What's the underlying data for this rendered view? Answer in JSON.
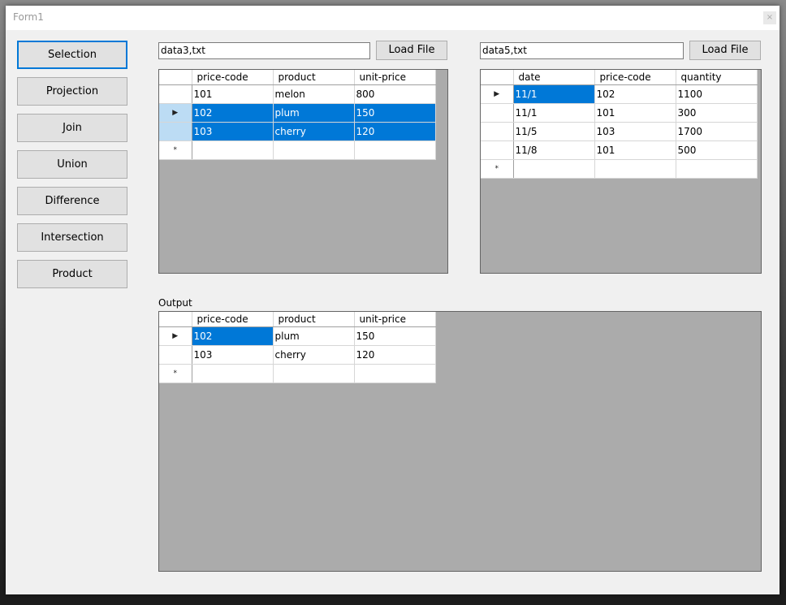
{
  "window": {
    "title": "Form1",
    "close_glyph": "×"
  },
  "sidebar": {
    "buttons": [
      {
        "label": "Selection"
      },
      {
        "label": "Projection"
      },
      {
        "label": "Join"
      },
      {
        "label": "Union"
      },
      {
        "label": "Difference"
      },
      {
        "label": "Intersection"
      },
      {
        "label": "Product"
      }
    ]
  },
  "left_panel": {
    "file_value": "data3,txt",
    "load_label": "Load File",
    "columns": [
      "price-code",
      "product",
      "unit-price"
    ],
    "rows": [
      [
        "101",
        "melon",
        "800"
      ],
      [
        "102",
        "plum",
        "150"
      ],
      [
        "103",
        "cherry",
        "120"
      ]
    ],
    "row_markers": [
      "",
      "▶",
      "",
      "*"
    ]
  },
  "right_panel": {
    "file_value": "data5,txt",
    "load_label": "Load File",
    "columns": [
      "date",
      "price-code",
      "quantity"
    ],
    "rows": [
      [
        "11/1",
        "102",
        "1100"
      ],
      [
        "11/1",
        "101",
        "300"
      ],
      [
        "11/5",
        "103",
        "1700"
      ],
      [
        "11/8",
        "101",
        "500"
      ]
    ],
    "row_markers": [
      "▶",
      "",
      "",
      "",
      "*"
    ]
  },
  "output": {
    "label": "Output",
    "columns": [
      "price-code",
      "product",
      "unit-price"
    ],
    "rows": [
      [
        "102",
        "plum",
        "150"
      ],
      [
        "103",
        "cherry",
        "120"
      ]
    ],
    "row_markers": [
      "▶",
      "",
      "*"
    ]
  },
  "colors": {
    "selection": "#0078d7",
    "grid_background": "#ababab",
    "window": "#f0f0f0"
  }
}
